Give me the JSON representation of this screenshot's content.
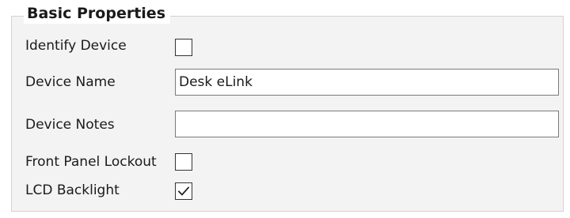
{
  "group": {
    "title": "Basic Properties"
  },
  "fields": {
    "identify_device": {
      "label": "Identify Device",
      "checked": false
    },
    "device_name": {
      "label": "Device Name",
      "value": "Desk eLink"
    },
    "device_notes": {
      "label": "Device Notes",
      "value": ""
    },
    "front_panel_lockout": {
      "label": "Front Panel Lockout",
      "checked": false
    },
    "lcd_backlight": {
      "label": "LCD Backlight",
      "checked": true
    }
  }
}
